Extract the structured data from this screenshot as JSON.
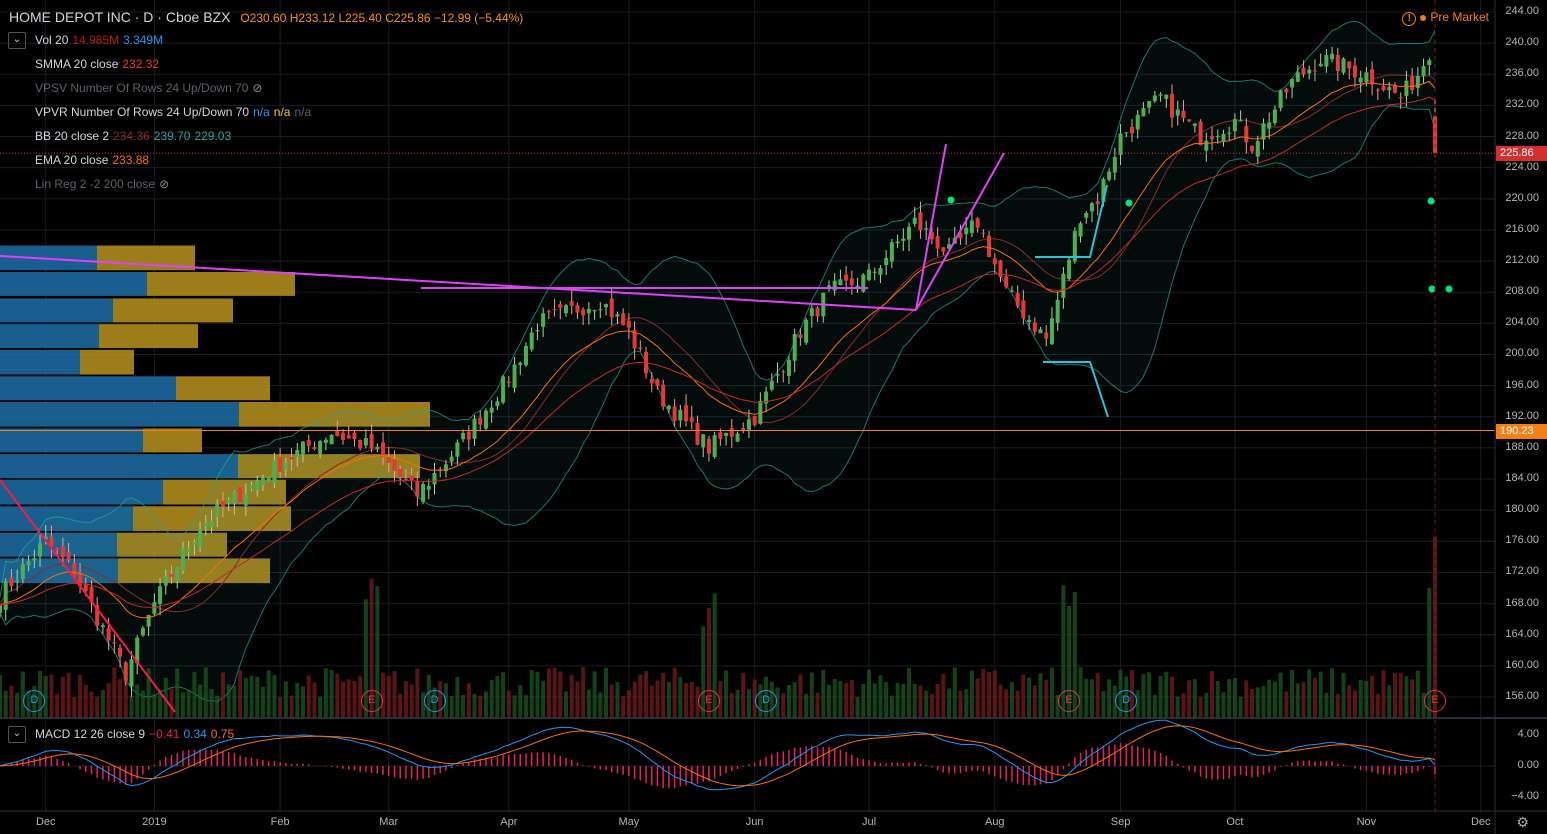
{
  "header": {
    "symbol": "HOME DEPOT INC · D · Cboe BZX",
    "open": "O230.60",
    "high": "H233.12",
    "low": "L225.40",
    "close": "C225.86",
    "change": "−12.99 (−5.44%)"
  },
  "status": {
    "label": "Pre Market",
    "icon": "warning-icon"
  },
  "indicators": {
    "vol": {
      "name": "Vol 20",
      "v1": "14.985M",
      "v2": "3.349M"
    },
    "smma": {
      "name": "SMMA 20 close",
      "v1": "232.32"
    },
    "vpsv": {
      "name": "VPSV Number Of Rows 24 Up/Down 70"
    },
    "vpvr": {
      "name": "VPVR Number Of Rows 24 Up/Down 70",
      "v1": "n/a",
      "v2": "n/a",
      "v3": "n/a"
    },
    "bb": {
      "name": "BB 20 close 2",
      "v1": "234.36",
      "v2": "239.70",
      "v3": "229.03"
    },
    "ema": {
      "name": "EMA 20 close",
      "v1": "233.88"
    },
    "linreg": {
      "name": "Lin Reg 2 -2 200 close"
    },
    "macd": {
      "name": "MACD 12 26 close 9",
      "v1": "−0.41",
      "v2": "0.34",
      "v3": "0.75"
    }
  },
  "price_axis": [
    "244.00",
    "240.00",
    "236.00",
    "232.00",
    "228.00",
    "224.00",
    "220.00",
    "216.00",
    "212.00",
    "208.00",
    "204.00",
    "200.00",
    "196.00",
    "192.00",
    "188.00",
    "184.00",
    "180.00",
    "176.00",
    "172.00",
    "168.00",
    "164.00",
    "160.00",
    "156.00"
  ],
  "macd_axis": [
    "4.00",
    "0.00",
    "−4.00"
  ],
  "last_price": {
    "value": 225.86,
    "label": "225.86",
    "color": "#d32f2f"
  },
  "hline": {
    "value": 190.23,
    "label": "190.23",
    "color": "#f57f17"
  },
  "time_axis": [
    {
      "label": "Dec",
      "bar": 8
    },
    {
      "label": "2019",
      "bar": 27
    },
    {
      "label": "Feb",
      "bar": 49
    },
    {
      "label": "Mar",
      "bar": 68
    },
    {
      "label": "Apr",
      "bar": 89
    },
    {
      "label": "May",
      "bar": 110
    },
    {
      "label": "Jun",
      "bar": 132
    },
    {
      "label": "Jul",
      "bar": 152
    },
    {
      "label": "Aug",
      "bar": 174
    },
    {
      "label": "Sep",
      "bar": 196
    },
    {
      "label": "Oct",
      "bar": 216
    },
    {
      "label": "Nov",
      "bar": 239
    },
    {
      "label": "Dec",
      "bar": 259
    }
  ],
  "events": [
    {
      "type": "D",
      "bar": 6
    },
    {
      "type": "E",
      "bar": 65
    },
    {
      "type": "D",
      "bar": 76
    },
    {
      "type": "E",
      "bar": 124
    },
    {
      "type": "D",
      "bar": 134
    },
    {
      "type": "E",
      "bar": 187
    },
    {
      "type": "D",
      "bar": 197
    },
    {
      "type": "E",
      "bar": 251
    }
  ],
  "colors": {
    "up": "#4caf50",
    "down": "#e53935",
    "ema": "#ff6d00",
    "smma": "#c62828",
    "bb": "#26a69a",
    "macd": "#2196f3",
    "signal": "#ff6d00",
    "hist": "#e91e63",
    "vp_up": "#1e6fa8",
    "vp_down": "#b8921f",
    "drawing": "#e040fb",
    "drawing2": "#26c6da"
  },
  "chart_data": {
    "type": "candlestick",
    "ylim": [
      154,
      245
    ],
    "close_anchors": [
      [
        0,
        169
      ],
      [
        8,
        176
      ],
      [
        13,
        172
      ],
      [
        22,
        159
      ],
      [
        27,
        168
      ],
      [
        35,
        178
      ],
      [
        49,
        186
      ],
      [
        58,
        190
      ],
      [
        65,
        188
      ],
      [
        73,
        182
      ],
      [
        80,
        188
      ],
      [
        89,
        197
      ],
      [
        94,
        204
      ],
      [
        105,
        207
      ],
      [
        110,
        203
      ],
      [
        115,
        195
      ],
      [
        124,
        188
      ],
      [
        132,
        192
      ],
      [
        140,
        203
      ],
      [
        145,
        208
      ],
      [
        152,
        210
      ],
      [
        160,
        217
      ],
      [
        166,
        213
      ],
      [
        171,
        217
      ],
      [
        176,
        208
      ],
      [
        183,
        202
      ],
      [
        185,
        207
      ],
      [
        189,
        218
      ],
      [
        192,
        220
      ],
      [
        196,
        228
      ],
      [
        203,
        233
      ],
      [
        210,
        228
      ],
      [
        216,
        230
      ],
      [
        219,
        227
      ],
      [
        226,
        235
      ],
      [
        231,
        238
      ],
      [
        239,
        236
      ],
      [
        245,
        233
      ],
      [
        248,
        236
      ],
      [
        250,
        239
      ],
      [
        251,
        225.86
      ]
    ],
    "last_bar": {
      "open": 230.6,
      "high": 233.12,
      "low": 225.4,
      "close": 225.86
    },
    "volume_profile": [
      {
        "from": 210.7,
        "to": 214,
        "up": 97,
        "down": 98
      },
      {
        "from": 207.4,
        "to": 210.6,
        "up": 147,
        "down": 148
      },
      {
        "from": 204,
        "to": 207.2,
        "up": 113,
        "down": 120
      },
      {
        "from": 200.7,
        "to": 203.9,
        "up": 99,
        "down": 99
      },
      {
        "from": 197.3,
        "to": 200.6,
        "up": 80,
        "down": 54
      },
      {
        "from": 194,
        "to": 197.2,
        "up": 176,
        "down": 94
      },
      {
        "from": 190.6,
        "to": 193.9,
        "up": 239,
        "down": 191
      },
      {
        "from": 187.3,
        "to": 190.5,
        "up": 143,
        "down": 59
      },
      {
        "from": 184,
        "to": 187.2,
        "up": 238,
        "down": 182
      },
      {
        "from": 180.6,
        "to": 183.9,
        "up": 163,
        "down": 123
      },
      {
        "from": 177.2,
        "to": 180.5,
        "up": 133,
        "down": 158
      },
      {
        "from": 173.9,
        "to": 177.1,
        "up": 117,
        "down": 110
      },
      {
        "from": 170.5,
        "to": 173.8,
        "up": 118,
        "down": 152
      }
    ]
  }
}
